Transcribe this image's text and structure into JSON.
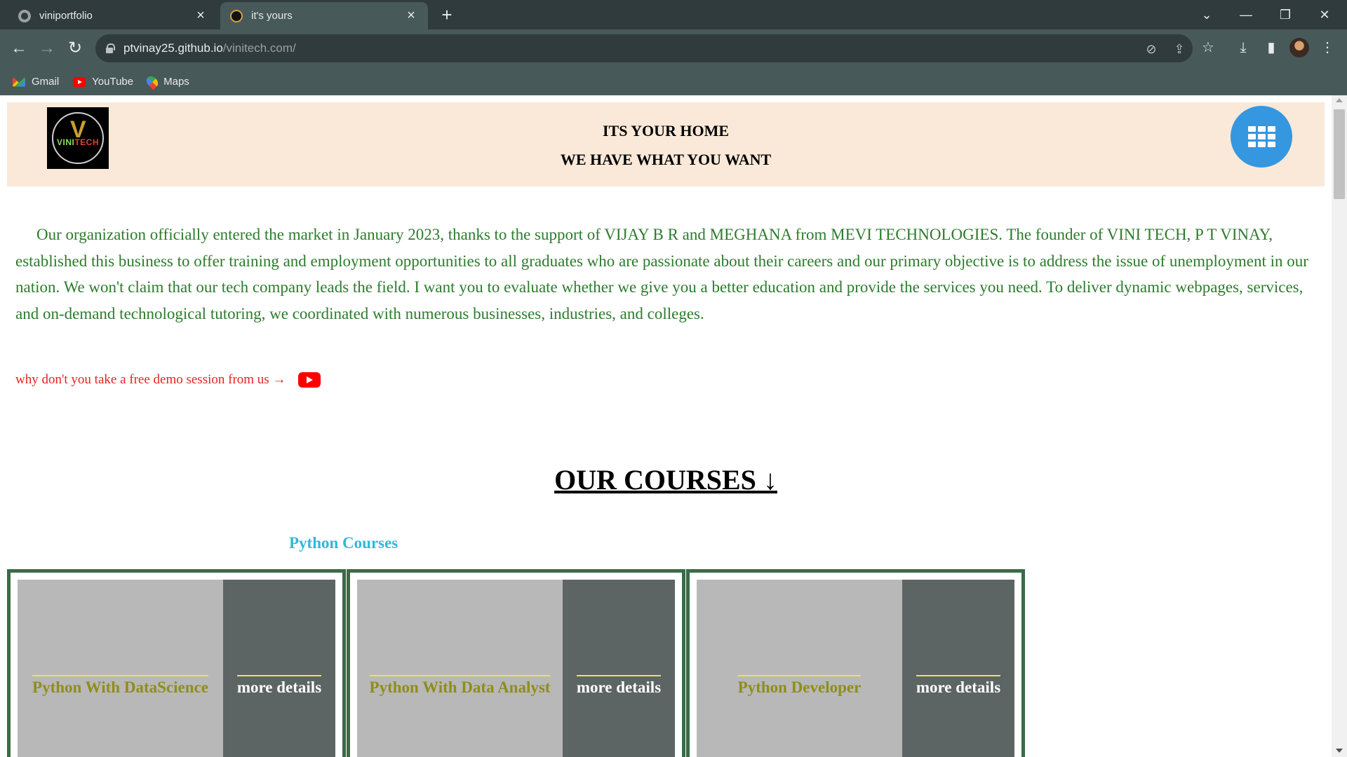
{
  "browser": {
    "tabs": [
      {
        "title": "viniportfolio",
        "active": false
      },
      {
        "title": "it's yours",
        "active": true
      }
    ],
    "new_tab_label": "+",
    "url_host": "ptvinay25.github.io",
    "url_path": "/vinitech.com/",
    "bookmarks": [
      {
        "label": "Gmail",
        "icon": "gmail-icon"
      },
      {
        "label": "YouTube",
        "icon": "youtube-icon"
      },
      {
        "label": "Maps",
        "icon": "maps-icon"
      }
    ],
    "icons": {
      "back": "←",
      "forward": "→",
      "reload": "↻",
      "tab_close": "×",
      "tab_search": "⌄",
      "minimize": "—",
      "restore": "❐",
      "close": "✕",
      "eye_off": "⊘",
      "share": "⇪",
      "star": "☆",
      "download": "⤓",
      "sidepanel": "▮",
      "menu": "⋮"
    }
  },
  "page": {
    "header": {
      "logo_text_a": "VINI",
      "logo_text_b": "TECH",
      "line1": "ITS YOUR HOME",
      "line2": "WE HAVE WHAT YOU WANT"
    },
    "about": "Our organization officially entered the market in January 2023, thanks to the support of VIJAY B R and MEGHANA from MEVI TECHNOLOGIES. The founder of VINI TECH, P T VINAY, established this business to offer training and employment opportunities to all graduates who are passionate about their careers and our primary objective is to address the issue of unemployment in our nation. We won't claim that our tech company leads the field. I want you to evaluate whether we give you a better education and provide the services you need. To deliver dynamic webpages, services, and on-demand technological tutoring, we coordinated with numerous businesses, industries, and colleges.",
    "demo_text": "why don't you take a free demo session from us →",
    "courses_title": "OUR COURSES ↓",
    "python_courses_title": "Python Courses",
    "courses": [
      {
        "name": "Python With DataScience",
        "action": "more details"
      },
      {
        "name": "Python With Data Analyst",
        "action": "more details"
      },
      {
        "name": "Python Developer",
        "action": "more details"
      }
    ],
    "colors": {
      "header_bg": "#fae9d8",
      "about_text": "#2d7b2d",
      "demo_text": "#e52222",
      "python_title": "#2fb9d9",
      "card_border": "#3b6b47",
      "card_left": "#b8b8b8",
      "card_right": "#5d6464",
      "course_name": "#8e8e1b",
      "menu_button": "#3497e0"
    }
  }
}
